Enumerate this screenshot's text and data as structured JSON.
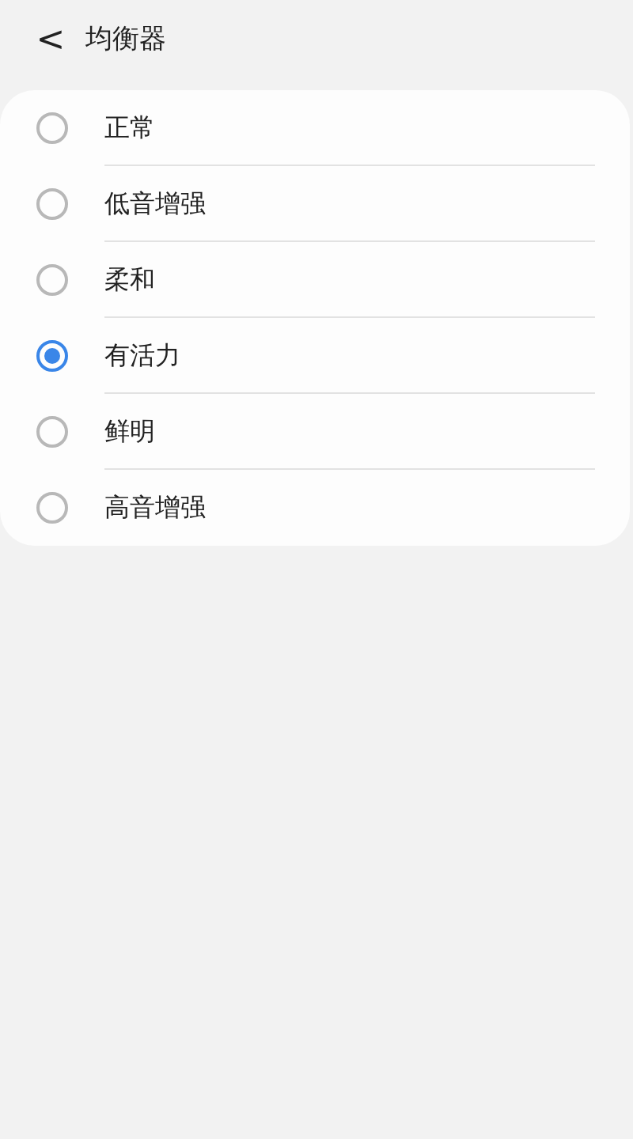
{
  "header": {
    "back": "<",
    "title": "均衡器"
  },
  "options": [
    {
      "label": "正常",
      "selected": false
    },
    {
      "label": "低音增强",
      "selected": false
    },
    {
      "label": "柔和",
      "selected": false
    },
    {
      "label": "有活力",
      "selected": true
    },
    {
      "label": "鲜明",
      "selected": false
    },
    {
      "label": "高音增强",
      "selected": false
    }
  ]
}
